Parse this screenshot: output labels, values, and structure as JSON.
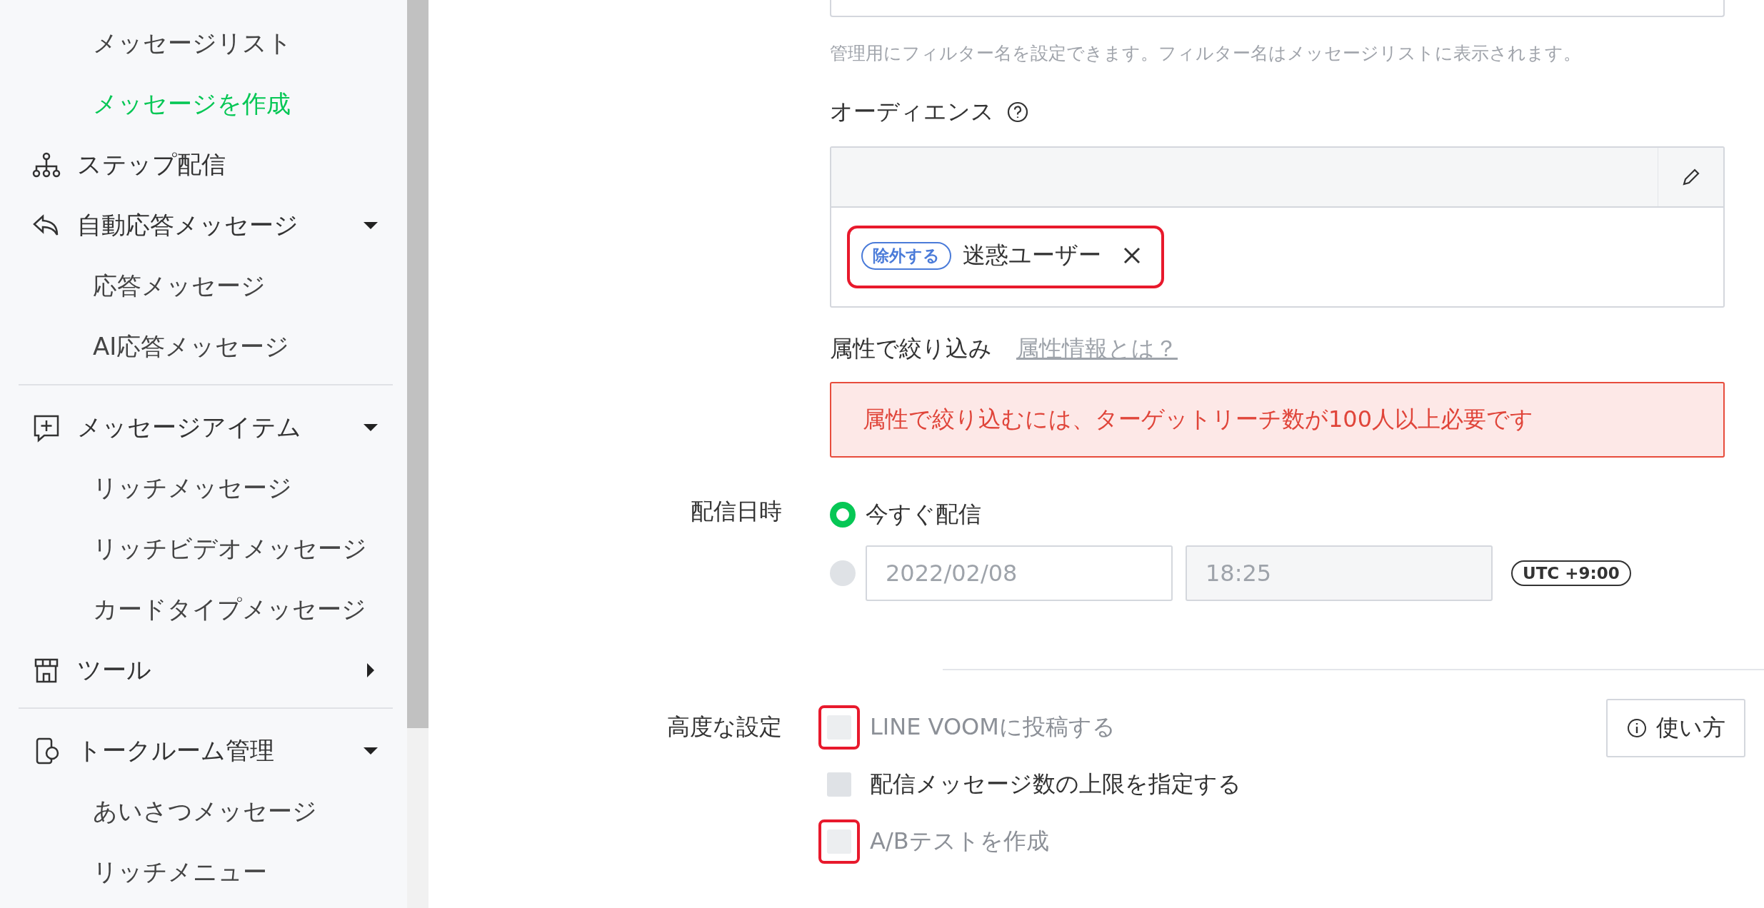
{
  "sidebar": {
    "groups": [
      {
        "items": [
          {
            "kind": "sub",
            "label": "メッセージリスト",
            "selected": false
          },
          {
            "kind": "sub",
            "label": "メッセージを作成",
            "selected": true
          },
          {
            "kind": "parent",
            "label": "ステップ配信"
          },
          {
            "kind": "parent",
            "label": "自動応答メッセージ",
            "expanded": true
          },
          {
            "kind": "sub",
            "label": "応答メッセージ",
            "selected": false
          },
          {
            "kind": "sub",
            "label": "AI応答メッセージ",
            "selected": false
          }
        ]
      },
      {
        "items": [
          {
            "kind": "parent",
            "label": "メッセージアイテム",
            "expanded": true
          },
          {
            "kind": "sub",
            "label": "リッチメッセージ",
            "selected": false
          },
          {
            "kind": "sub",
            "label": "リッチビデオメッセージ",
            "selected": false
          },
          {
            "kind": "sub",
            "label": "カードタイプメッセージ",
            "selected": false
          },
          {
            "kind": "parent",
            "label": "ツール",
            "expanded": false
          }
        ]
      },
      {
        "items": [
          {
            "kind": "parent",
            "label": "トークルーム管理",
            "expanded": true
          },
          {
            "kind": "sub",
            "label": "あいさつメッセージ",
            "selected": false
          },
          {
            "kind": "sub",
            "label": "リッチメニュー",
            "selected": false
          }
        ]
      }
    ]
  },
  "form": {
    "filter_hint": "管理用にフィルター名を設定できます。フィルター名はメッセージリストに表示されます。",
    "audience": {
      "label": "オーディエンス",
      "tag": {
        "badge": "除外する",
        "name": "迷惑ユーザー",
        "annotated": true
      }
    },
    "attribute": {
      "label": "属性で絞り込み",
      "link": "属性情報とは？",
      "error": "属性で絞り込むには、ターゲットリーチ数が100人以上必要です"
    },
    "schedule": {
      "label": "配信日時",
      "options": [
        {
          "kind": "now",
          "label": "今すぐ配信",
          "selected": true
        },
        {
          "kind": "datetime",
          "date": "2022/02/08",
          "time": "18:25",
          "timezone": "UTC +9:00",
          "selected": false
        }
      ]
    },
    "advanced": {
      "label": "高度な設定",
      "help_button": "使い方",
      "options": [
        {
          "label": "LINE VOOMに投稿する",
          "checked": false,
          "disabled": true,
          "annotated": true
        },
        {
          "label": "配信メッセージ数の上限を指定する",
          "checked": false,
          "disabled": false,
          "annotated": false
        },
        {
          "label": "A/Bテストを作成",
          "checked": false,
          "disabled": true,
          "annotated": true
        }
      ]
    }
  }
}
